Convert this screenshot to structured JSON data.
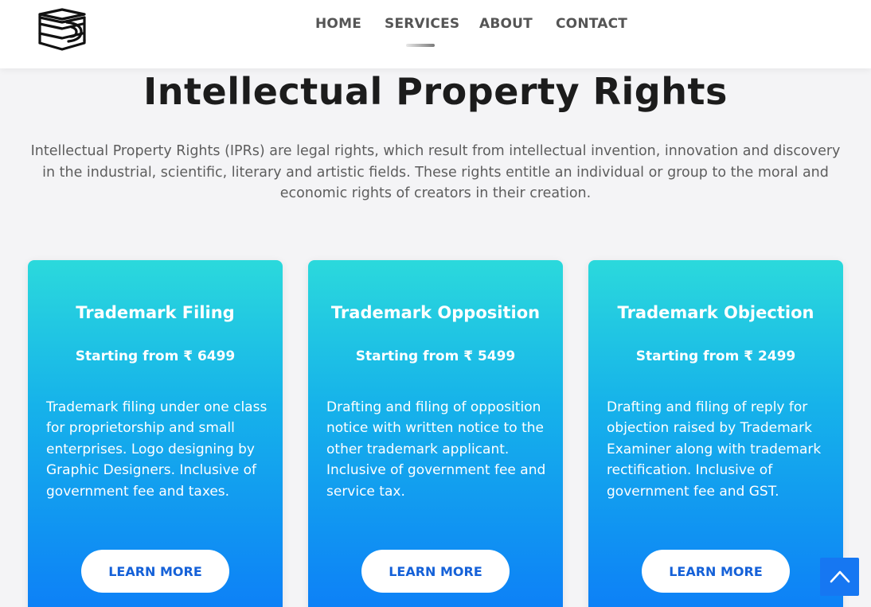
{
  "header": {
    "logo_icon": "stacked-books-logo-icon",
    "nav": [
      {
        "label": "HOME",
        "active": false
      },
      {
        "label": "SERVICES",
        "active": true
      },
      {
        "label": "ABOUT",
        "active": false
      },
      {
        "label": "CONTACT",
        "active": false
      }
    ]
  },
  "main": {
    "title": "Intellectual Property Rights",
    "intro": "Intellectual Property Rights (IPRs) are legal rights, which result from intellectual invention, innovation and discovery in the industrial, scientific, literary and artistic fields. These rights entitle an individual or group to the moral and economic rights of creators in their creation."
  },
  "cards": [
    {
      "title": "Trademark Filing",
      "price": "Starting from ₹ 6499",
      "description": "Trademark filing under one class for proprietorship and small enterprises. Logo designing by Graphic Designers. Inclusive of government fee and taxes.",
      "button": "LEARN MORE"
    },
    {
      "title": "Trademark Opposition",
      "price": "Starting from ₹ 5499",
      "description": "Drafting and filing of opposition notice with written notice to the other trademark applicant. Inclusive of government fee and service tax.",
      "button": "LEARN MORE"
    },
    {
      "title": "Trademark Objection",
      "price": "Starting from ₹ 2499",
      "description": "Drafting and filing of reply for objection raised by Trademark Examiner along with trademark rectification. Inclusive of government fee and GST.",
      "button": "LEARN MORE"
    }
  ],
  "scroll_top": {
    "icon": "chevron-up-icon"
  },
  "colors": {
    "card_gradient_top": "#2bd9dc",
    "card_gradient_bottom": "#0c7cf8",
    "button_text": "#1561d8",
    "scroll_top_bg": "#1677f2"
  }
}
